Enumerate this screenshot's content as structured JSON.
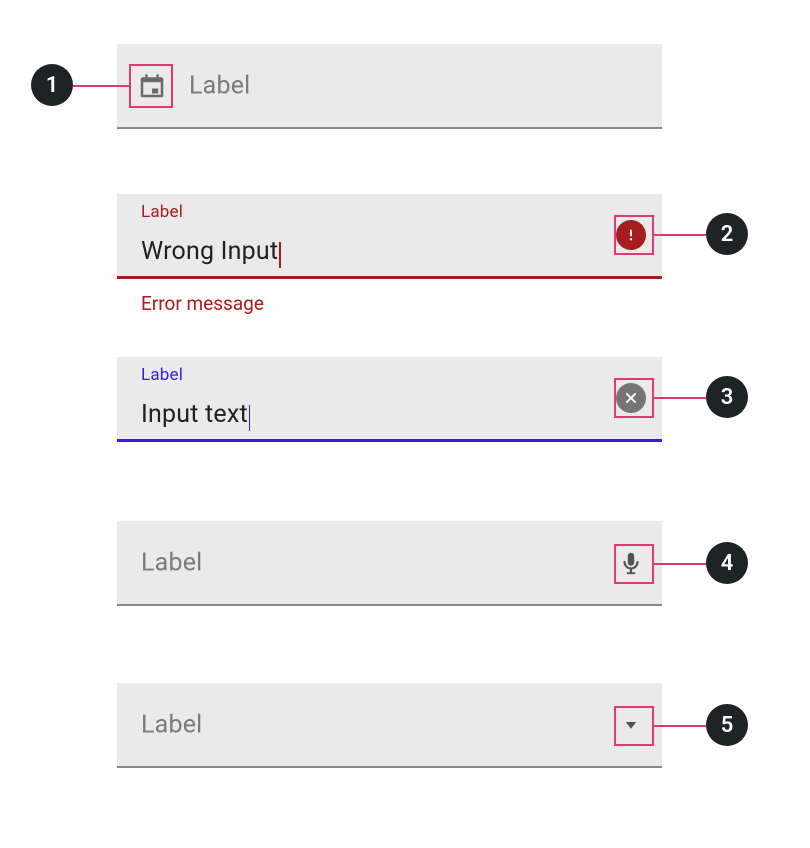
{
  "annotations": {
    "a1": "1",
    "a2": "2",
    "a3": "3",
    "a4": "4",
    "a5": "5"
  },
  "field1": {
    "placeholder": "Label",
    "leading_icon": "calendar-icon"
  },
  "field2": {
    "label": "Label",
    "value": "Wrong Input",
    "trailing_icon": "error-icon",
    "error_message": "Error message",
    "state": "error"
  },
  "field3": {
    "label": "Label",
    "value": "Input text",
    "trailing_icon": "clear-icon",
    "state": "focused"
  },
  "field4": {
    "placeholder": "Label",
    "trailing_icon": "microphone-icon"
  },
  "field5": {
    "placeholder": "Label",
    "trailing_icon": "dropdown-icon"
  },
  "colors": {
    "error": "#a71c1c",
    "focus": "#3b1ce3",
    "annotation": "#e13a71"
  }
}
